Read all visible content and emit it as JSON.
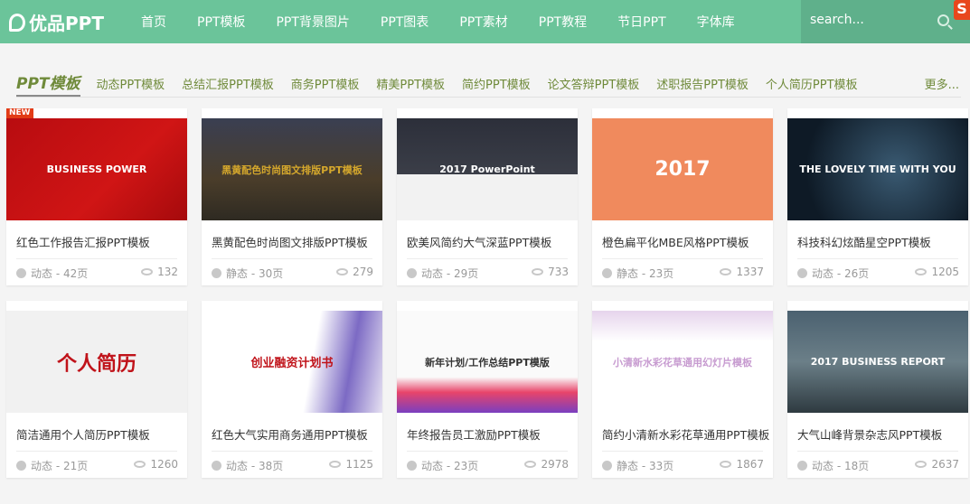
{
  "header": {
    "logo": "优品PPT",
    "menu": [
      "首页",
      "PPT模板",
      "PPT背景图片",
      "PPT图表",
      "PPT素材",
      "PPT教程",
      "节日PPT",
      "字体库"
    ],
    "search_placeholder": "search...",
    "badge": "S"
  },
  "categories": {
    "title": "PPT模板",
    "items": [
      "动态PPT模板",
      "总结汇报PPT模板",
      "商务PPT模板",
      "精美PPT模板",
      "简约PPT模板",
      "论文答辩PPT模板",
      "述职报告PPT模板",
      "个人简历PPT模板"
    ],
    "more": "更多..."
  },
  "cards": [
    {
      "title": "红色工作报告汇报PPT模板",
      "meta": "动态 - 42页",
      "views": "132",
      "badge": "NEW",
      "thumb": "BUSINESS POWER",
      "bg": "linear-gradient(135deg,#b80c10,#d01515 60%,#a50a0c)",
      "fg": "#fff"
    },
    {
      "title": "黑黄配色时尚图文排版PPT模板",
      "meta": "静态 - 30页",
      "views": "279",
      "thumb": "黑黄配色时尚图文排版PPT模板",
      "bg": "linear-gradient(180deg,#3a3f52,#4a3d2a 60%,#2e2a22)",
      "fg": "#d4a72c"
    },
    {
      "title": "欧美风简约大气深蓝PPT模板",
      "meta": "动态 - 29页",
      "views": "733",
      "thumb": "2017 PowerPoint",
      "bg": "linear-gradient(180deg,#2c2f3a 0,#3b3e48 55%,#f2f2f2 55%)",
      "fg": "#fff"
    },
    {
      "title": "橙色扁平化MBE风格PPT模板",
      "meta": "静态 - 23页",
      "views": "1337",
      "thumb": "2017",
      "bg": "#f08a5d",
      "fg": "#fff"
    },
    {
      "title": "科技科幻炫酷星空PPT模板",
      "meta": "动态 - 26页",
      "views": "1205",
      "thumb": "THE LOVELY TIME WITH YOU",
      "bg": "radial-gradient(circle at 60% 50%,#3a5a72,#0e1a26 75%)",
      "fg": "#fff"
    },
    {
      "title": "简洁通用个人简历PPT模板",
      "meta": "动态 - 21页",
      "views": "1260",
      "thumb": "个人简历",
      "bg": "#f1f1f1",
      "fg": "#c0131a"
    },
    {
      "title": "红色大气实用商务通用PPT模板",
      "meta": "动态 - 38页",
      "views": "1125",
      "thumb": "创业融资计划书",
      "bg": "linear-gradient(100deg,#fff 60%,#7c6ac4 80%,#e6e1f2)",
      "fg": "#c0131a"
    },
    {
      "title": "年终报告员工激励PPT模板",
      "meta": "动态 - 23页",
      "views": "2978",
      "thumb": "新年计划/工作总结PPT模版",
      "bg": "linear-gradient(180deg,#fafafa 65%,#e8446a 80%,#7a3fc0)",
      "fg": "#333"
    },
    {
      "title": "简约小清新水彩花草通用PPT模板",
      "meta": "静态 - 33页",
      "views": "1867",
      "thumb": "小清新水彩花草通用幻灯片模板",
      "bg": "linear-gradient(180deg,#e6d4ec 0,#fff 30%)",
      "fg": "#c79bd0"
    },
    {
      "title": "大气山峰背景杂志风PPT模板",
      "meta": "动态 - 18页",
      "views": "2637",
      "thumb": "2017 BUSINESS REPORT",
      "bg": "linear-gradient(180deg,#4b6170,#6b7f88 50%,#2e3a40)",
      "fg": "#fff"
    }
  ]
}
